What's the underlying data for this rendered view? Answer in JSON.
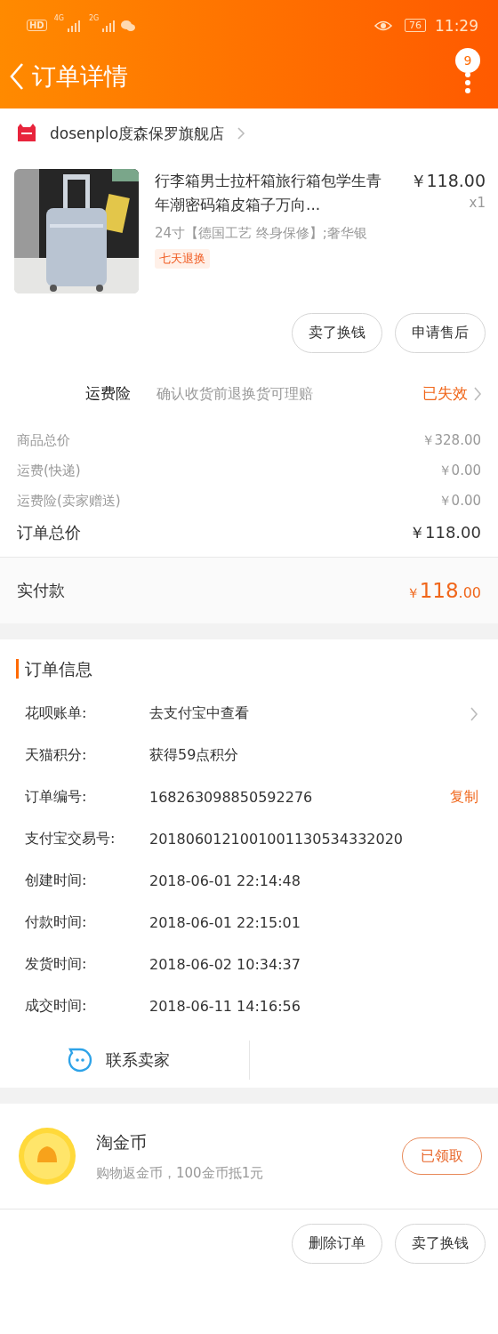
{
  "status_bar": {
    "hd": "HD",
    "net1": "4G",
    "net2": "2G",
    "battery": "76",
    "time": "11:29"
  },
  "nav": {
    "title": "订单详情",
    "badge": "9"
  },
  "store": {
    "name": "dosenplo度森保罗旗舰店"
  },
  "product": {
    "kind": "picture",
    "title": "行李箱男士拉杆箱旅行箱包学生青年潮密码箱皮箱子万向...",
    "price": "￥118.00",
    "qty": "x1",
    "spec": "24寸【德国工艺 终身保修】;奢华银",
    "tag": "七天退换"
  },
  "product_buttons": [
    "卖了换钱",
    "申请售后"
  ],
  "insurance": {
    "label": "运费险",
    "desc": "确认收货前退换货可理赔",
    "status": "已失效"
  },
  "costs": [
    {
      "label": "商品总价",
      "value": "￥328.00"
    },
    {
      "label": "运费(快递)",
      "value": "￥0.00"
    },
    {
      "label": "运费险(卖家赠送)",
      "value": "￥0.00"
    }
  ],
  "order_total": {
    "label": "订单总价",
    "value": "￥118.00"
  },
  "paid": {
    "label": "实付款",
    "currency": "￥",
    "amount": "118",
    "cents": ".00"
  },
  "order_info": {
    "heading": "订单信息",
    "rows": [
      {
        "label": "花呗账单:",
        "value": "去支付宝中查看",
        "chevron": true
      },
      {
        "label": "天猫积分:",
        "value": "获得59点积分",
        "chevron": false
      },
      {
        "label": "订单编号:",
        "value": "168263098850592276",
        "action": "复制",
        "chevron": false
      },
      {
        "label": "支付宝交易号:",
        "value": "2018060121001001130534332020",
        "chevron": false
      },
      {
        "label": "创建时间:",
        "value": "2018-06-01 22:14:48",
        "chevron": false
      },
      {
        "label": "付款时间:",
        "value": "2018-06-01 22:15:01",
        "chevron": false
      },
      {
        "label": "发货时间:",
        "value": "2018-06-02 10:34:37",
        "chevron": false
      },
      {
        "label": "成交时间:",
        "value": "2018-06-11 14:16:56",
        "chevron": false
      }
    ]
  },
  "contact": {
    "label": "联系卖家"
  },
  "coins": {
    "title": "淘金币",
    "desc": "购物返金币，100金币抵1元",
    "button": "已领取"
  },
  "bottom_buttons": [
    "删除订单",
    "卖了换钱"
  ]
}
